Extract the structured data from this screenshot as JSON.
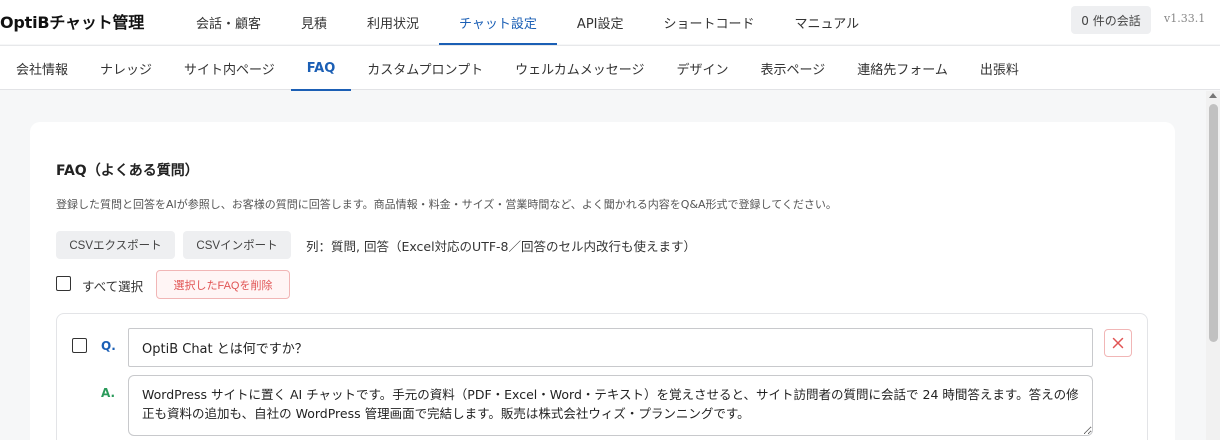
{
  "app": {
    "title": "OptiBチャット管理",
    "version": "v1.33.1",
    "conversations": "0 件の会話"
  },
  "topnav": [
    {
      "label": "会話・顧客"
    },
    {
      "label": "見積"
    },
    {
      "label": "利用状況"
    },
    {
      "label": "チャット設定",
      "active": true
    },
    {
      "label": "API設定"
    },
    {
      "label": "ショートコード"
    },
    {
      "label": "マニュアル"
    }
  ],
  "subnav": [
    {
      "label": "会社情報"
    },
    {
      "label": "ナレッジ"
    },
    {
      "label": "サイト内ページ"
    },
    {
      "label": "FAQ",
      "active": true
    },
    {
      "label": "カスタムプロンプト"
    },
    {
      "label": "ウェルカムメッセージ"
    },
    {
      "label": "デザイン"
    },
    {
      "label": "表示ページ"
    },
    {
      "label": "連絡先フォーム"
    },
    {
      "label": "出張料"
    }
  ],
  "faq": {
    "title": "FAQ（よくある質問）",
    "description": "登録した質問と回答をAIが参照し、お客様の質問に回答します。商品情報・料金・サイズ・営業時間など、よく聞かれる内容をQ&A形式で登録してください。",
    "csv_export": "CSVエクスポート",
    "csv_import": "CSVインポート",
    "csv_note": "列：質問, 回答（Excel対応のUTF-8／回答のセル内改行も使えます）",
    "select_all": "すべて選択",
    "delete_selected": "選択したFAQを削除",
    "items": [
      {
        "q_label": "Q.",
        "a_label": "A.",
        "question": "OptiB Chat とは何ですか？",
        "answer": "WordPress サイトに置く AI チャットです。手元の資料（PDF・Excel・Word・テキスト）を覚えさせると、サイト訪問者の質問に会話で 24 時間答えます。答えの修正も資料の追加も、自社の WordPress 管理画面で完結します。販売は株式会社ウィズ・プランニングです。"
      }
    ]
  },
  "colors": {
    "accent": "#1b5fb5",
    "answer": "#2a9a5a",
    "danger": "#e15454"
  },
  "icons": {
    "delete": "close-icon",
    "scroll": "chevron-up-icon"
  }
}
